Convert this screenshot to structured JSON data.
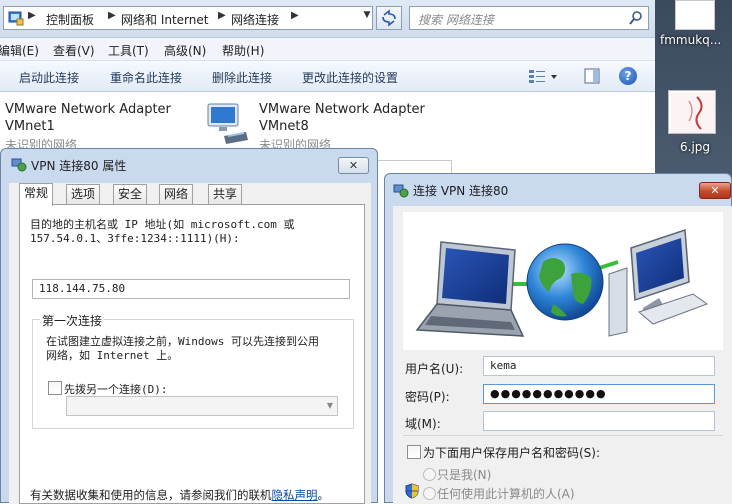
{
  "address_bar": {
    "crumbs": [
      "控制面板",
      "网络和 Internet",
      "网络连接"
    ],
    "search_placeholder": "搜索 网络连接"
  },
  "menu_bar": [
    "编辑(E)",
    "查看(V)",
    "工具(T)",
    "高级(N)",
    "帮助(H)"
  ],
  "command_bar": [
    "启动此连接",
    "重命名此连接",
    "删除此连接",
    "更改此连接的设置"
  ],
  "adapters": [
    {
      "name": "VMware Network Adapter",
      "id": "VMnet1",
      "status": "未识别的网络"
    },
    {
      "name": "VMware Network Adapter",
      "id": "VMnet8",
      "status": "未识别的网络"
    }
  ],
  "desktop": {
    "file1_label": "fmmukq...",
    "file2_label": "6.jpg"
  },
  "props_dialog": {
    "title": "VPN 连接80 属性",
    "tabs": [
      "常规",
      "选项",
      "安全",
      "网络",
      "共享"
    ],
    "host_label_1": "目的地的主机名或 IP 地址(如 microsoft.com 或",
    "host_label_2": "157.54.0.1、3ffe:1234::1111)(H):",
    "host_value": "118.144.75.80",
    "first_connect_title": "第一次连接",
    "first_connect_desc_1": "在试图建立虚拟连接之前，Windows 可以先连接到公用",
    "first_connect_desc_2": "网络，如 Internet 上。",
    "dial_checkbox_label": "先拨另一个连接(D):",
    "privacy_text": "有关数据收集和使用的信息，请参阅我们的联机",
    "privacy_link": "隐私声明",
    "privacy_end": "。"
  },
  "connect_dialog": {
    "title": "连接 VPN 连接80",
    "username_label": "用户名(U):",
    "username_value": "kema",
    "password_label": "密码(P):",
    "password_value": "●●●●●●●●●●●",
    "domain_label": "域(M):",
    "domain_value": "",
    "save_checkbox_label": "为下面用户保存用户名和密码(S):",
    "radio_me": "只是我(N)",
    "radio_anyone": "任何使用此计算机的人(A)"
  }
}
